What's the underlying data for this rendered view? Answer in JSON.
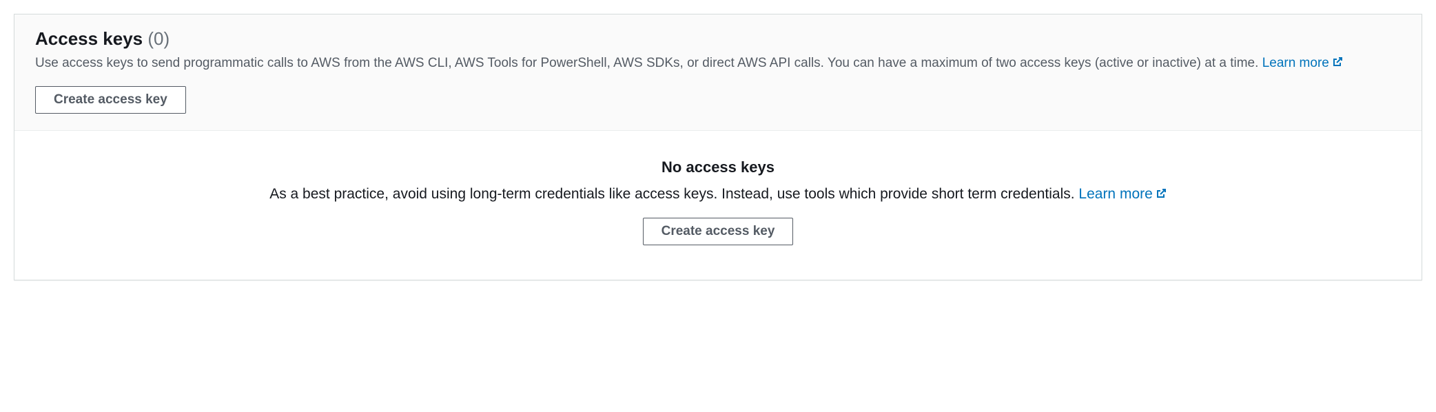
{
  "header": {
    "title": "Access keys",
    "count": "(0)",
    "description": "Use access keys to send programmatic calls to AWS from the AWS CLI, AWS Tools for PowerShell, AWS SDKs, or direct AWS API calls. You can have a maximum of two access keys (active or inactive) at a time. ",
    "learn_more": "Learn more",
    "create_button": "Create access key"
  },
  "empty": {
    "title": "No access keys",
    "description": "As a best practice, avoid using long-term credentials like access keys. Instead, use tools which provide short term credentials. ",
    "learn_more": "Learn more",
    "create_button": "Create access key"
  },
  "colors": {
    "link": "#0073bb",
    "border": "#d5dbdb",
    "text_primary": "#16191f",
    "text_secondary": "#545b64"
  }
}
